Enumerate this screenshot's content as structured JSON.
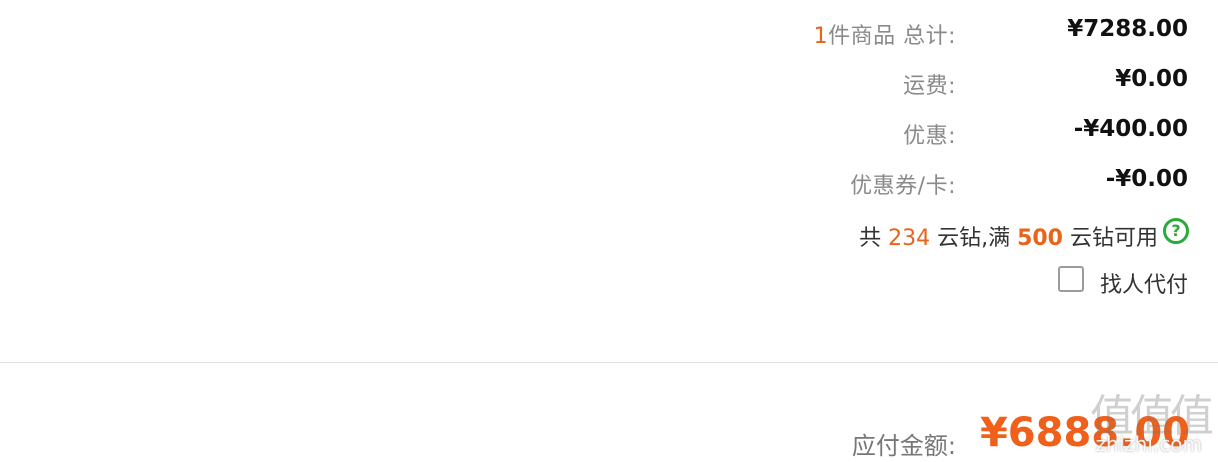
{
  "summary": {
    "items": {
      "count": "1",
      "count_suffix": "件商品 总计:",
      "value": "¥7288.00"
    },
    "shipping": {
      "label": "运费:",
      "value": "¥0.00"
    },
    "discount": {
      "label": "优惠:",
      "value": "-¥400.00"
    },
    "coupon": {
      "label": "优惠券/卡:",
      "value": "-¥0.00"
    }
  },
  "diamonds": {
    "prefix": "共 ",
    "count": "234",
    "middle": " 云钻,满 ",
    "threshold": "500",
    "suffix": " 云钻可用",
    "help_icon_glyph": "?",
    "help_icon_color": "#2aaa3a"
  },
  "pay_for_me": {
    "label": "找人代付",
    "checked": false
  },
  "total": {
    "label": "应付金额:",
    "value": "¥6888.00",
    "color": "#f0601a"
  },
  "watermark": {
    "logo": "值值值",
    "site": "zhizhi.com"
  }
}
